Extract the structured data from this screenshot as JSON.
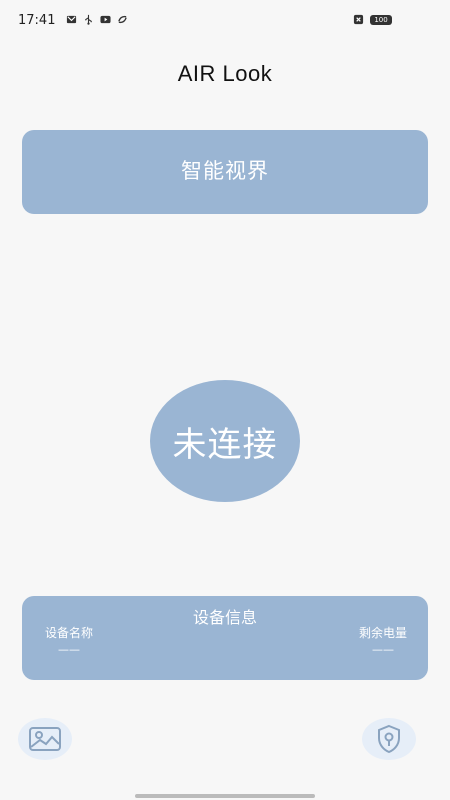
{
  "status_bar": {
    "time": "17:41",
    "battery": "100"
  },
  "header": {
    "title": "AIR Look"
  },
  "banner": {
    "label": "智能视界"
  },
  "connection": {
    "status": "未连接"
  },
  "device_info": {
    "title": "设备信息",
    "name_label": "设备名称",
    "name_value": "——",
    "battery_label": "剩余电量",
    "battery_value": "——"
  },
  "colors": {
    "card": "#9ab5d3",
    "fab": "#e6eef8",
    "background": "#f7f7f7"
  },
  "icons": {
    "gallery": "image-icon",
    "lock": "shield-lock-icon"
  }
}
